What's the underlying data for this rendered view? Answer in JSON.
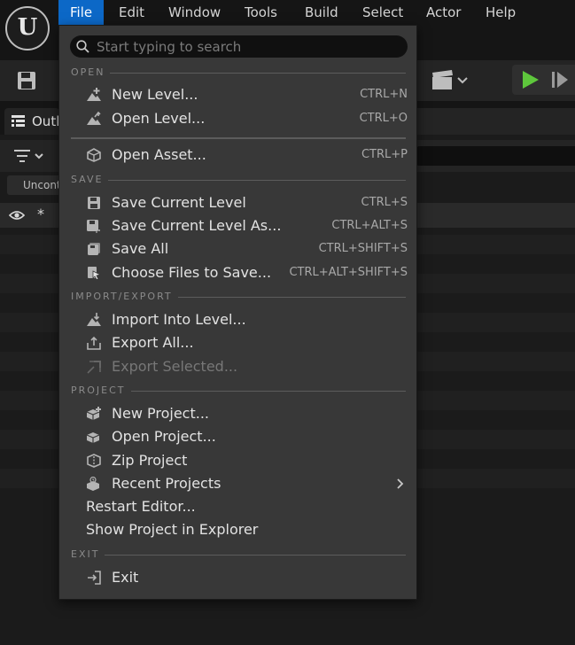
{
  "menubar": {
    "items": [
      {
        "label": "File"
      },
      {
        "label": "Edit"
      },
      {
        "label": "Window"
      },
      {
        "label": "Tools"
      },
      {
        "label": "Build"
      },
      {
        "label": "Select"
      },
      {
        "label": "Actor"
      },
      {
        "label": "Help"
      }
    ],
    "active_color": "#0c68c7"
  },
  "background": {
    "outliner_tab_label": "Outl",
    "filter_chip_label": "Uncont",
    "header_star": "*",
    "play_color": "#5ec73c"
  },
  "dropdown": {
    "search_placeholder": "Start typing to search",
    "sections": {
      "open": "OPEN",
      "save": "SAVE",
      "import_export": "IMPORT/EXPORT",
      "project": "PROJECT",
      "exit": "EXIT"
    },
    "items": {
      "new_level": {
        "label": "New Level...",
        "shortcut": "CTRL+N",
        "icon": "new-level-icon"
      },
      "open_level": {
        "label": "Open Level...",
        "shortcut": "CTRL+O",
        "icon": "open-level-icon"
      },
      "open_asset": {
        "label": "Open Asset...",
        "shortcut": "CTRL+P",
        "icon": "open-asset-icon"
      },
      "save_current_level": {
        "label": "Save Current Level",
        "shortcut": "CTRL+S",
        "icon": "save-icon"
      },
      "save_current_level_as": {
        "label": "Save Current Level As...",
        "shortcut": "CTRL+ALT+S",
        "icon": "save-as-icon"
      },
      "save_all": {
        "label": "Save All",
        "shortcut": "CTRL+SHIFT+S",
        "icon": "save-all-icon"
      },
      "choose_files": {
        "label": "Choose Files to Save...",
        "shortcut": "CTRL+ALT+SHIFT+S",
        "icon": "choose-files-icon"
      },
      "import_into_level": {
        "label": "Import Into Level...",
        "icon": "import-icon"
      },
      "export_all": {
        "label": "Export All...",
        "icon": "export-icon"
      },
      "export_selected": {
        "label": "Export Selected...",
        "icon": "export-selected-icon",
        "disabled": true
      },
      "new_project": {
        "label": "New Project...",
        "icon": "new-project-icon"
      },
      "open_project": {
        "label": "Open Project...",
        "icon": "open-project-icon"
      },
      "zip_project": {
        "label": "Zip Project",
        "icon": "zip-project-icon"
      },
      "recent_projects": {
        "label": "Recent Projects",
        "icon": "recent-projects-icon",
        "submenu": true
      },
      "restart_editor": {
        "label": "Restart Editor..."
      },
      "show_in_explorer": {
        "label": "Show Project in Explorer"
      },
      "exit": {
        "label": "Exit",
        "icon": "exit-icon"
      }
    }
  }
}
